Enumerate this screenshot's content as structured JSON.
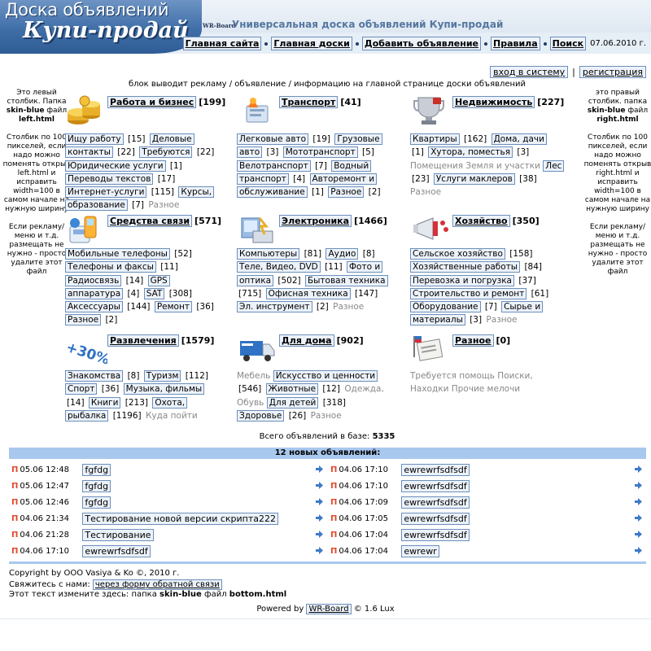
{
  "header": {
    "logo_title": "Доска объявлений",
    "logo_subtitle": "Купи-продай",
    "brand_mark": "WR-Board",
    "slogan": "Универсальная доска объявлений Купи-продай",
    "nav": [
      "Главная сайта",
      "Главная доски",
      "Добавить объявление",
      "Правила",
      "Поиск"
    ],
    "date": "07.06.2010 г."
  },
  "auth": {
    "login": "вход в систему",
    "separator": "|",
    "register": "регистрация"
  },
  "left_col": {
    "p1a": "Это левый столбик. Папка",
    "p1b": "skin-blue",
    "p1c": "файл",
    "p1d": "left.html",
    "p2": "Столбик по 100 пикселей, если надо можно поменять открыв left.html и исправить width=100 в самом начале на нужную ширину",
    "p3": "Если рекламу/меню и т.д. размещать не нужно - просто удалите этот файл"
  },
  "right_col": {
    "p1a": "это правый столбик. папка",
    "p1b": "skin-blue",
    "p1c": "файл",
    "p1d": "right.html",
    "p2": "Столбик по 100 пикселей, если надо можно поменять открыв right.html и исправить width=100 в самом начале на нужную ширину",
    "p3": "Если рекламу/меню и т.д. размещать не нужно - просто удалите этот файл"
  },
  "notice": "блок выводит рекламу / объявление / информацию на главной странице доски объявлений",
  "categories": [
    {
      "title": "Работа и бизнес",
      "count": "[199]",
      "icon": "coins-icon",
      "subs": [
        [
          "Ищу работу",
          "[15]"
        ],
        [
          "Деловые контакты",
          "[22]"
        ],
        [
          "Требуются",
          "[22]"
        ],
        [
          "Юридические услуги",
          "[1]"
        ],
        [
          "Переводы текстов",
          "[17]"
        ],
        [
          "Интернет-услуги",
          "[115]"
        ],
        [
          "Курсы, образование",
          "[7]"
        ]
      ],
      "empty": [
        "Разное"
      ]
    },
    {
      "title": "Транспорт",
      "count": "[41]",
      "icon": "car-key-icon",
      "subs": [
        [
          "Легковые авто",
          "[19]"
        ],
        [
          "Грузовые авто",
          "[3]"
        ],
        [
          "Мототранспорт",
          "[5]"
        ],
        [
          "Велотранспорт",
          "[7]"
        ],
        [
          "Водный транспорт",
          "[4]"
        ],
        [
          "Авторемонт и обслуживание",
          "[1]"
        ],
        [
          "Разное",
          "[2]"
        ]
      ],
      "empty": []
    },
    {
      "title": "Недвижимость",
      "count": "[227]",
      "icon": "trophy-icon",
      "subs": [
        [
          "Квартиры",
          "[162]"
        ],
        [
          "Дома, дачи",
          "[1]"
        ],
        [
          "Хутора, поместья",
          "[3]"
        ]
      ],
      "empty": [
        "Помещения",
        "Земля и участки"
      ],
      "subs2": [
        [
          "Лес",
          "[23]"
        ],
        [
          "Услуги маклеров",
          "[38]"
        ]
      ],
      "empty2": [
        "Разное"
      ]
    },
    {
      "title": "Средства связи",
      "count": "[571]",
      "icon": "phone-icon",
      "subs": [
        [
          "Мобильные телефоны",
          "[52]"
        ],
        [
          "Телефоны и факсы",
          "[11]"
        ],
        [
          "Радиосвязь",
          "[14]"
        ],
        [
          "GPS аппаратура",
          "[4]"
        ],
        [
          "SAT",
          "[308]"
        ],
        [
          "Аксессуары",
          "[144]"
        ],
        [
          "Ремонт",
          "[36]"
        ],
        [
          "Разное",
          "[2]"
        ]
      ],
      "empty": []
    },
    {
      "title": "Электроника",
      "count": "[1466]",
      "icon": "electronics-icon",
      "subs": [
        [
          "Компьютеры",
          "[81]"
        ],
        [
          "Аудио",
          "[8]"
        ],
        [
          "Теле, Видео, DVD",
          "[11]"
        ],
        [
          "Фото и оптика",
          "[502]"
        ],
        [
          "Бытовая техника",
          "[715]"
        ],
        [
          "Офисная техника",
          "[147]"
        ],
        [
          "Эл. инструмент",
          "[2]"
        ]
      ],
      "empty": [
        "Разное"
      ]
    },
    {
      "title": "Хозяйство",
      "count": "[350]",
      "icon": "megaphone-icon",
      "subs": [
        [
          "Сельское хозяйство",
          "[158]"
        ],
        [
          "Хозяйственные работы",
          "[84]"
        ],
        [
          "Перевозка и погрузка",
          "[37]"
        ],
        [
          "Строительство и ремонт",
          "[61]"
        ],
        [
          "Оборудование",
          "[7]"
        ],
        [
          "Сырье и материалы",
          "[3]"
        ]
      ],
      "empty": [
        "Разное"
      ]
    },
    {
      "title": "Развлечения",
      "count": "[1579]",
      "icon": "percent-icon",
      "icon_text": "+30%",
      "subs": [
        [
          "Знакомства",
          "[8]"
        ],
        [
          "Туризм",
          "[112]"
        ],
        [
          "Спорт",
          "[36]"
        ],
        [
          "Музыка, фильмы",
          "[14]"
        ],
        [
          "Книги",
          "[213]"
        ],
        [
          "Охота, рыбалка",
          "[1196]"
        ]
      ],
      "empty": [
        "Куда пойти"
      ]
    },
    {
      "title": "Для дома",
      "count": "[902]",
      "icon": "truck-icon",
      "pre_empty": [
        "Мебель"
      ],
      "subs": [
        [
          "Искусство и ценности",
          "[546]"
        ],
        [
          "Животные",
          "[12]"
        ]
      ],
      "empty": [
        "Одежда, Обувь"
      ],
      "subs2": [
        [
          "Для детей",
          "[318]"
        ],
        [
          "Здоровье",
          "[26]"
        ]
      ],
      "empty2": [
        "Разное"
      ]
    },
    {
      "title": "Разное",
      "count": "[0]",
      "icon": "newspaper-icon",
      "subs": [],
      "empty": [
        "Требуется помощь",
        "Поиски, Находки",
        "Прочие мелочи"
      ]
    }
  ],
  "total": {
    "label": "Всего объявлений в базе:",
    "value": "5335"
  },
  "new_ads": {
    "header": "12 новых объявлений:",
    "left": [
      {
        "time": "05.06 12:48",
        "title": "fgfdg"
      },
      {
        "time": "05.06 12:47",
        "title": "fgfdg"
      },
      {
        "time": "05.06 12:46",
        "title": "fgfdg"
      },
      {
        "time": "04.06 21:34",
        "title": "Тестирование новой версии скрипта222"
      },
      {
        "time": "04.06 21:28",
        "title": "Тестирование"
      },
      {
        "time": "04.06 17:10",
        "title": "ewrewrfsdfsdf"
      }
    ],
    "right": [
      {
        "time": "04.06 17:10",
        "title": "ewrewrfsdfsdf"
      },
      {
        "time": "04.06 17:10",
        "title": "ewrewrfsdfsdf"
      },
      {
        "time": "04.06 17:09",
        "title": "ewrewrfsdfsdf"
      },
      {
        "time": "04.06 17:05",
        "title": "ewrewrfsdfsdf"
      },
      {
        "time": "04.06 17:04",
        "title": "ewrewrfsdfsdf"
      },
      {
        "time": "04.06 17:04",
        "title": "ewrewr"
      }
    ],
    "marker": "П"
  },
  "footer": {
    "copyright": "Copyright by ООО Vasiya & Ko ©, 2010 г.",
    "contact_label": "Свяжитесь с нами:",
    "contact_link": "через форму обратной связи",
    "edit_prefix": "Этот текст измените здесь: папка",
    "edit_skin": "skin-blue",
    "edit_mid": "файл",
    "edit_file": "bottom.html",
    "powered_label": "Powered by",
    "powered_link": "WR-Board",
    "powered_version": "© 1.6 Lux"
  }
}
